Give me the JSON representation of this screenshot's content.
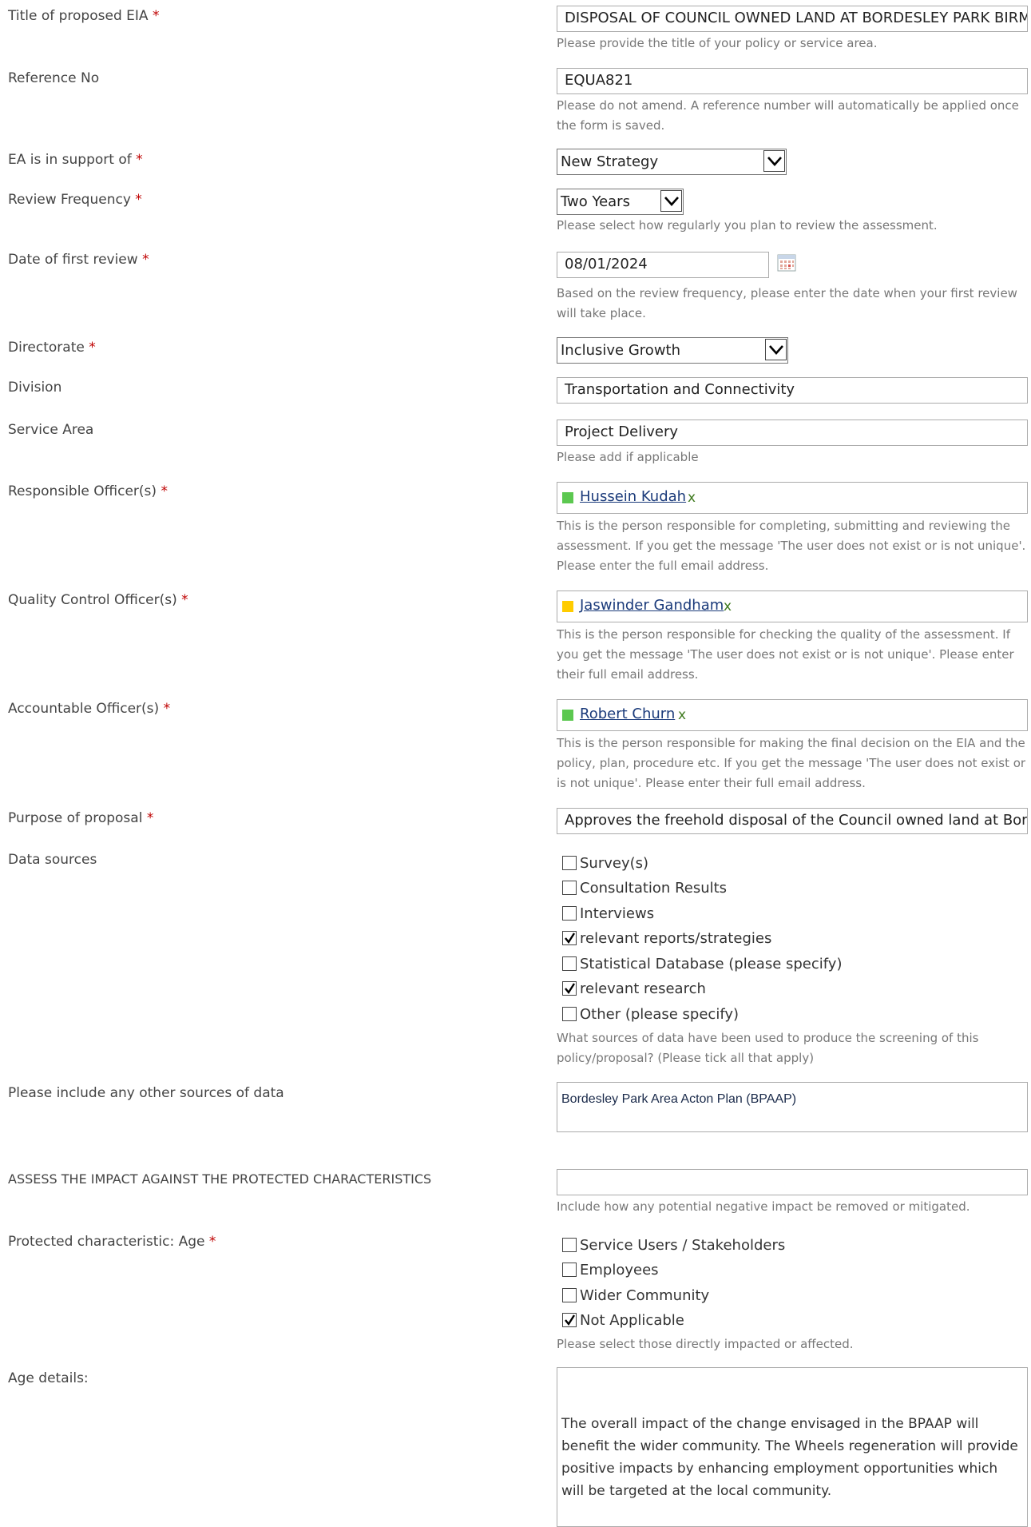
{
  "required_marker": "*",
  "fields": {
    "title": {
      "label": "Title of proposed EIA",
      "value": "DISPOSAL OF COUNCIL OWNED LAND AT BORDESLEY PARK BIRMINGHAM",
      "hint": "Please provide the title of your policy or service area."
    },
    "reference": {
      "label": "Reference No",
      "value": "EQUA821",
      "hint": "Please do not amend. A reference number will automatically be applied once the form is saved."
    },
    "support_of": {
      "label": "EA is in support of",
      "value": "New Strategy"
    },
    "review_frequency": {
      "label": "Review Frequency",
      "value": "Two Years",
      "hint": "Please select how regularly you plan to review the assessment."
    },
    "first_review": {
      "label": "Date of first review",
      "value": "08/01/2024",
      "hint": "Based on the review frequency, please enter the date when your first review will take place."
    },
    "directorate": {
      "label": "Directorate",
      "value": "Inclusive Growth"
    },
    "division": {
      "label": "Division",
      "value": "Transportation and Connectivity"
    },
    "service_area": {
      "label": "Service Area",
      "value": "Project Delivery",
      "hint": "Please add if applicable"
    },
    "responsible_officer": {
      "label": "Responsible Officer(s)",
      "name": "Hussein Kudah",
      "remove": "x",
      "presence_color": "#5cc850",
      "hint": "This is the person responsible for completing, submitting and reviewing the assessment. If you get the message 'The user does not exist or is not unique'. Please enter the full email address."
    },
    "quality_officer": {
      "label": "Quality Control Officer(s)",
      "name": "Jaswinder Gandham",
      "remove": "x",
      "presence_color": "#ffcc00",
      "hint": "This is the person responsible for checking the quality of the assessment. If you get the message 'The user does not exist or is not unique'. Please enter their full email address."
    },
    "accountable_officer": {
      "label": "Accountable Officer(s)",
      "name": "Robert Churn",
      "remove": "x",
      "presence_color": "#5cc850",
      "hint": "This is the person responsible for making the final decision on the EIA and the policy, plan, procedure etc. If you get the message 'The user does not exist or is not unique'. Please enter their full email address."
    },
    "purpose": {
      "label": "Purpose of proposal",
      "value": "Approves the freehold disposal of the Council owned land at Bordesley Park"
    },
    "data_sources": {
      "label": "Data sources",
      "options": [
        {
          "label": "Survey(s)",
          "checked": false
        },
        {
          "label": "Consultation Results",
          "checked": false
        },
        {
          "label": "Interviews",
          "checked": false
        },
        {
          "label": "relevant reports/strategies",
          "checked": true
        },
        {
          "label": "Statistical Database (please specify)",
          "checked": false
        },
        {
          "label": "relevant research",
          "checked": true
        },
        {
          "label": "Other (please specify)",
          "checked": false
        }
      ],
      "hint": "What sources of data have been used to produce the screening of this policy/proposal? (Please tick all that apply)"
    },
    "other_sources": {
      "label": "Please include any other sources of data",
      "value": "Bordesley Park Area Acton Plan (BPAAP)"
    },
    "assess_impact": {
      "label": "ASSESS THE IMPACT AGAINST THE PROTECTED CHARACTERISTICS",
      "value": "",
      "hint": "Include how any potential negative impact be removed or mitigated."
    },
    "age": {
      "label": "Protected characteristic: Age",
      "options": [
        {
          "label": "Service Users / Stakeholders",
          "checked": false
        },
        {
          "label": "Employees",
          "checked": false
        },
        {
          "label": "Wider Community",
          "checked": false
        },
        {
          "label": "Not Applicable",
          "checked": true
        }
      ],
      "hint": "Please select those directly impacted or affected."
    },
    "age_details": {
      "label": "Age details:",
      "value": "The overall impact of the change envisaged in the BPAAP will benefit the wider community. The Wheels regeneration will provide positive impacts by enhancing employment opportunities which will be targeted at the local community."
    }
  }
}
